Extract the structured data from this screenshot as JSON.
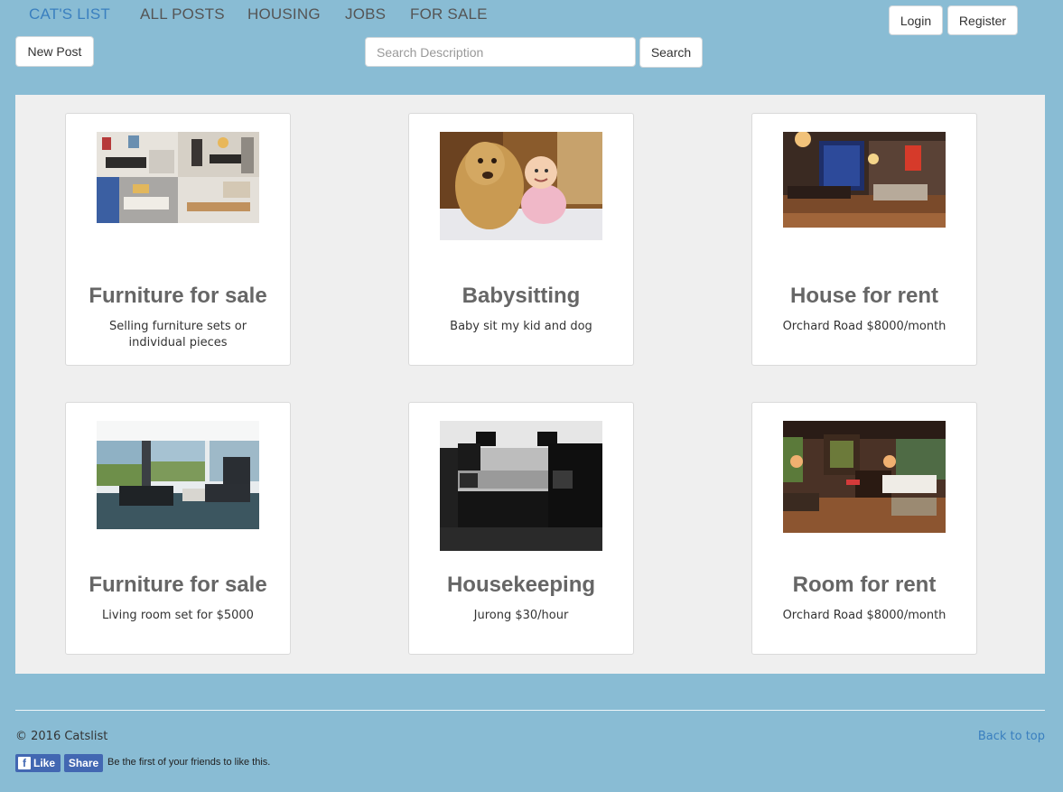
{
  "nav": {
    "brand": "CAT'S LIST",
    "links": [
      "ALL POSTS",
      "HOUSING",
      "JOBS",
      "FOR SALE"
    ],
    "login": "Login",
    "register": "Register"
  },
  "toolbar": {
    "new_post": "New Post",
    "search_placeholder": "Search Description",
    "search_value": "",
    "search_button": "Search"
  },
  "posts": [
    {
      "title": "Furniture for sale",
      "description": "Selling furniture sets or individual pieces",
      "image": "furniture-collage-photo"
    },
    {
      "title": "Babysitting",
      "description": "Baby sit my kid and dog",
      "image": "baby-and-dog-photo"
    },
    {
      "title": "House for rent",
      "description": "Orchard Road $8000/month",
      "image": "house-interior-photo"
    },
    {
      "title": "Furniture for sale",
      "description": "Living room set for $5000",
      "image": "living-room-photo"
    },
    {
      "title": "Housekeeping",
      "description": "Jurong $30/hour",
      "image": "black-kitchen-photo"
    },
    {
      "title": "Room for rent",
      "description": "Orchard Road $8000/month",
      "image": "bedroom-photo"
    }
  ],
  "footer": {
    "copyright": "© 2016 Catslist",
    "back_to_top": "Back to top",
    "fb_like": "Like",
    "fb_share": "Share",
    "fb_text": "Be the first of your friends to like this."
  },
  "colors": {
    "background": "#89bcd4",
    "panel": "#efefef",
    "brand": "#3a7fbf",
    "facebook": "#4267b2"
  }
}
